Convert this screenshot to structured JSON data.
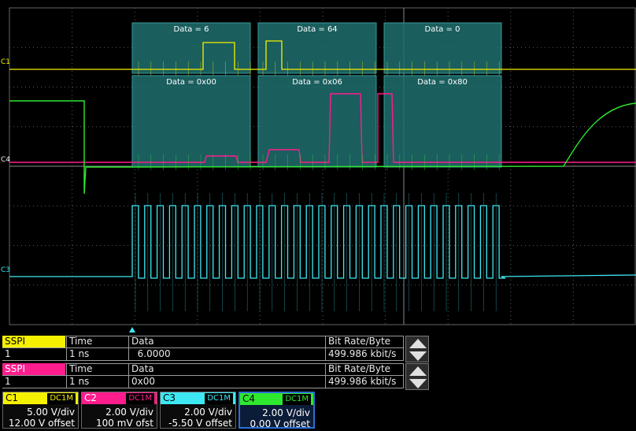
{
  "channel_markers": {
    "c1": "C1",
    "c4": "C4",
    "c3": "C3"
  },
  "decode_labels": {
    "ch1": [
      "Data =  6",
      "Data = 64",
      "Data =  0"
    ],
    "ch2": [
      "Data = 0x00",
      "Data = 0x06",
      "Data = 0x80"
    ]
  },
  "tables": [
    {
      "name": "SSPI",
      "name_color": "#f5f000",
      "name_text_color": "#000000",
      "headers": [
        "Time",
        "Data",
        "Bit Rate/Byte"
      ],
      "row": {
        "index": "1",
        "time": "1 ns",
        "data": "  6.0000",
        "rate": "499.986 kbit/s"
      }
    },
    {
      "name": "SSPI",
      "name_color": "#ff1c8d",
      "name_text_color": "#ffffff",
      "headers": [
        "Time",
        "Data",
        "Bit Rate/Byte"
      ],
      "row": {
        "index": "1",
        "time": "1 ns",
        "data": "0x00",
        "rate": "499.986 kbit/s"
      }
    }
  ],
  "channels": [
    {
      "label": "C1",
      "coupling": "DC1M",
      "vdiv": "5.00 V/div",
      "offset": "12.00 V offset",
      "color": "#f5f000"
    },
    {
      "label": "C2",
      "coupling": "DC1M",
      "vdiv": "2.00 V/div",
      "offset": "100 mV ofst",
      "color": "#ff1c8d"
    },
    {
      "label": "C3",
      "coupling": "DC1M",
      "vdiv": "2.00 V/div",
      "offset": "-5.50 V offset",
      "color": "#3ee8f2"
    },
    {
      "label": "C4",
      "coupling": "DC1M",
      "vdiv": "2.00 V/div",
      "offset": "0.00 V offset",
      "color": "#2ee82e"
    }
  ],
  "colors": {
    "c1": "#f5f000",
    "c2": "#ff1c8d",
    "c3": "#3ee8f2",
    "c4": "#2ee82e",
    "decode_bg": "#1f6e6e",
    "grid": "#555555"
  }
}
